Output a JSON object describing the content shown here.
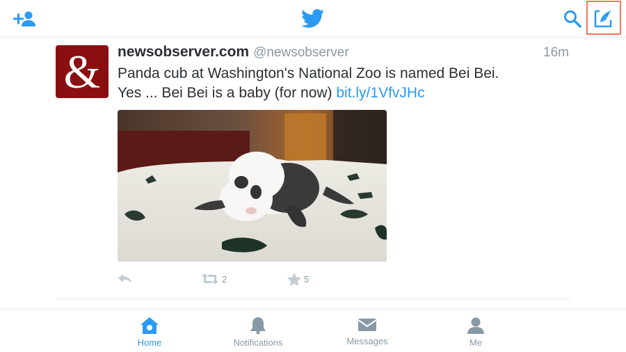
{
  "colors": {
    "accent": "#2b9af2",
    "text": "#292f33",
    "muted": "#8899a6",
    "highlight_box": "#f0785a",
    "avatar_bg": "#8b0e11"
  },
  "topbar": {
    "left_icon": "add-user-icon",
    "center_icon": "twitter-bird-icon",
    "right_icons": [
      "search-icon",
      "compose-tweet-icon"
    ]
  },
  "tweet": {
    "avatar_glyph": "&",
    "display_name": "newsobserver.com",
    "screen_name": "@newsobserver",
    "time": "16m",
    "text_line1": "Panda cub at Washington's National Zoo is named Bei Bei.",
    "text_line2": "Yes ... Bei Bei is a baby (for now) ",
    "link": "bit.ly/1VfvJHc",
    "media_description_icon": "photo-panda-cub",
    "actions": {
      "reply_icon": "reply-icon",
      "retweet_icon": "retweet-icon",
      "retweet_count": "2",
      "favorite_icon": "star-icon",
      "favorite_count": "5"
    }
  },
  "tabs": [
    {
      "label": "Home",
      "icon": "home-icon",
      "active": true
    },
    {
      "label": "Notifications",
      "icon": "bell-icon",
      "active": false
    },
    {
      "label": "Messages",
      "icon": "envelope-icon",
      "active": false
    },
    {
      "label": "Me",
      "icon": "person-icon",
      "active": false
    }
  ]
}
